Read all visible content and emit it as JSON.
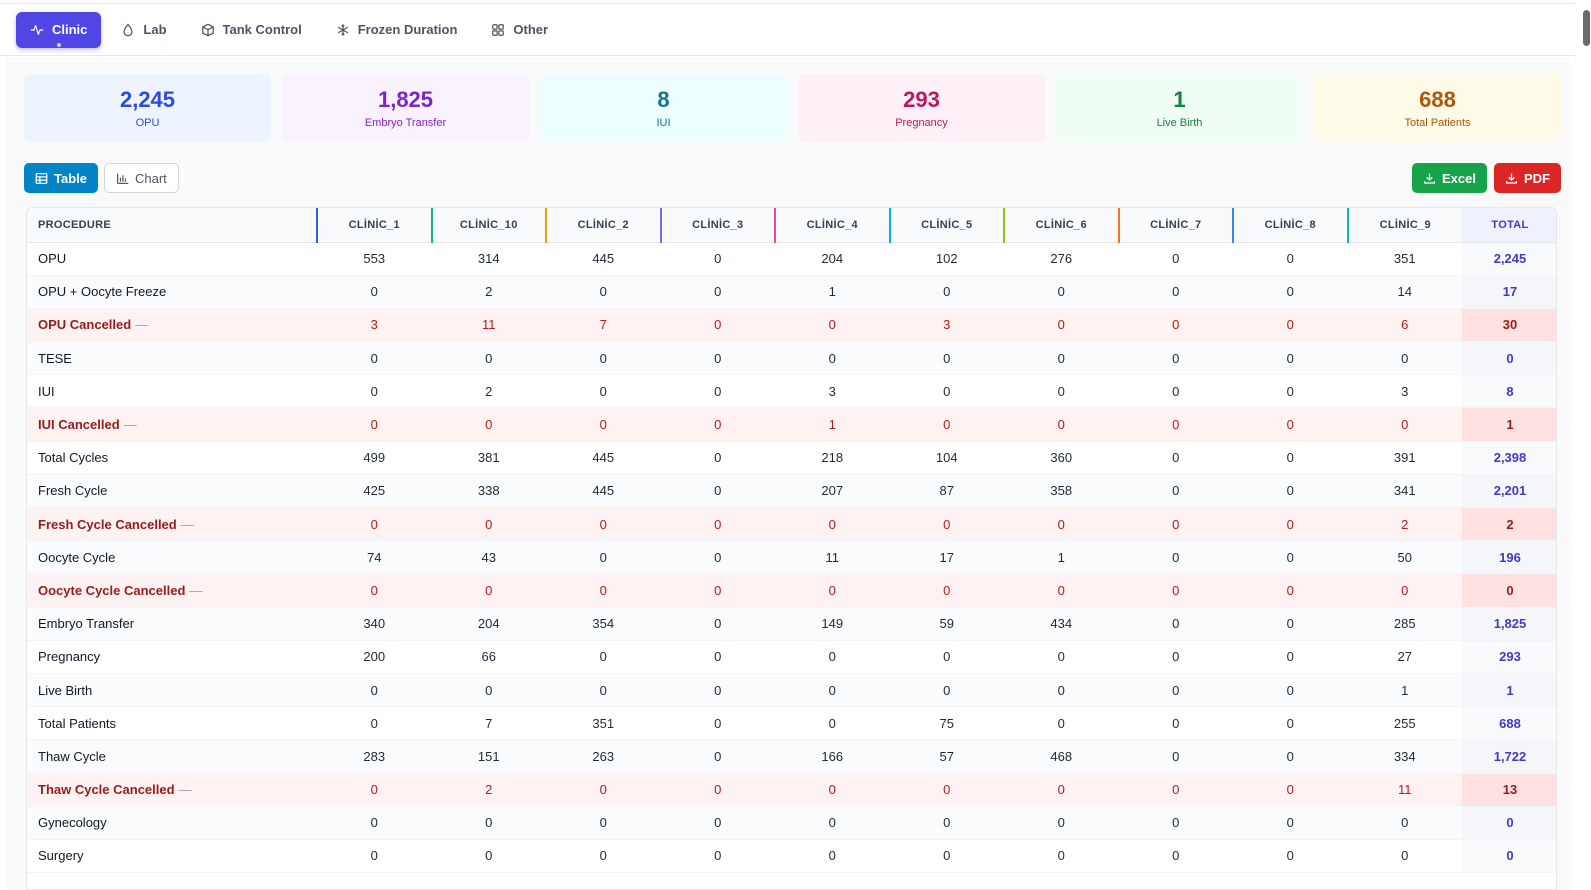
{
  "tabs": [
    {
      "label": "Clinic",
      "icon": "activity-icon",
      "active": true
    },
    {
      "label": "Lab",
      "icon": "droplet-icon",
      "active": false
    },
    {
      "label": "Tank Control",
      "icon": "box-icon",
      "active": false
    },
    {
      "label": "Frozen Duration",
      "icon": "snowflake-icon",
      "active": false
    },
    {
      "label": "Other",
      "icon": "grid-icon",
      "active": false
    }
  ],
  "stats": [
    {
      "value": "2,245",
      "label": "OPU",
      "bg": "#eef4ff",
      "color": "#2b4bd8"
    },
    {
      "value": "1,825",
      "label": "Embryo Transfer",
      "bg": "#faf2ff",
      "color": "#7e22ce"
    },
    {
      "value": "8",
      "label": "IUI",
      "bg": "#ecfeff",
      "color": "#0e7490"
    },
    {
      "value": "293",
      "label": "Pregnancy",
      "bg": "#fdf0f6",
      "color": "#be185d"
    },
    {
      "value": "1",
      "label": "Live Birth",
      "bg": "#f0fdf4",
      "color": "#15803d"
    },
    {
      "value": "688",
      "label": "Total Patients",
      "bg": "#fefce8",
      "color": "#b45309"
    }
  ],
  "toolbar": {
    "table_label": "Table",
    "chart_label": "Chart",
    "excel_label": "Excel",
    "pdf_label": "PDF"
  },
  "table": {
    "proc_header": "PROCEDURE",
    "total_header": "TOTAL",
    "cancel_marker": "—",
    "columns": [
      {
        "label": "CLİNİC_1",
        "color": "#2563eb"
      },
      {
        "label": "CLİNİC_10",
        "color": "#10b981"
      },
      {
        "label": "CLİNİC_2",
        "color": "#f59e0b"
      },
      {
        "label": "CLİNİC_3",
        "color": "#8b5cf6"
      },
      {
        "label": "CLİNİC_4",
        "color": "#ec4899"
      },
      {
        "label": "CLİNİC_5",
        "color": "#06b6d4"
      },
      {
        "label": "CLİNİC_6",
        "color": "#84cc16"
      },
      {
        "label": "CLİNİC_7",
        "color": "#f97316"
      },
      {
        "label": "CLİNİC_8",
        "color": "#3b82f6"
      },
      {
        "label": "CLİNİC_9",
        "color": "#14b8a6"
      }
    ],
    "rows": [
      {
        "name": "OPU",
        "cancel": false,
        "values": [
          "553",
          "314",
          "445",
          "0",
          "204",
          "102",
          "276",
          "0",
          "0",
          "351"
        ],
        "total": "2,245"
      },
      {
        "name": "OPU + Oocyte Freeze",
        "cancel": false,
        "values": [
          "0",
          "2",
          "0",
          "0",
          "1",
          "0",
          "0",
          "0",
          "0",
          "14"
        ],
        "total": "17"
      },
      {
        "name": "OPU Cancelled",
        "cancel": true,
        "values": [
          "3",
          "11",
          "7",
          "0",
          "0",
          "3",
          "0",
          "0",
          "0",
          "6"
        ],
        "total": "30"
      },
      {
        "name": "TESE",
        "cancel": false,
        "values": [
          "0",
          "0",
          "0",
          "0",
          "0",
          "0",
          "0",
          "0",
          "0",
          "0"
        ],
        "total": "0"
      },
      {
        "name": "IUI",
        "cancel": false,
        "values": [
          "0",
          "2",
          "0",
          "0",
          "3",
          "0",
          "0",
          "0",
          "0",
          "3"
        ],
        "total": "8"
      },
      {
        "name": "IUI Cancelled",
        "cancel": true,
        "values": [
          "0",
          "0",
          "0",
          "0",
          "1",
          "0",
          "0",
          "0",
          "0",
          "0"
        ],
        "total": "1"
      },
      {
        "name": "Total Cycles",
        "cancel": false,
        "values": [
          "499",
          "381",
          "445",
          "0",
          "218",
          "104",
          "360",
          "0",
          "0",
          "391"
        ],
        "total": "2,398"
      },
      {
        "name": "Fresh Cycle",
        "cancel": false,
        "values": [
          "425",
          "338",
          "445",
          "0",
          "207",
          "87",
          "358",
          "0",
          "0",
          "341"
        ],
        "total": "2,201"
      },
      {
        "name": "Fresh Cycle Cancelled",
        "cancel": true,
        "values": [
          "0",
          "0",
          "0",
          "0",
          "0",
          "0",
          "0",
          "0",
          "0",
          "2"
        ],
        "total": "2"
      },
      {
        "name": "Oocyte Cycle",
        "cancel": false,
        "values": [
          "74",
          "43",
          "0",
          "0",
          "11",
          "17",
          "1",
          "0",
          "0",
          "50"
        ],
        "total": "196"
      },
      {
        "name": "Oocyte Cycle Cancelled",
        "cancel": true,
        "values": [
          "0",
          "0",
          "0",
          "0",
          "0",
          "0",
          "0",
          "0",
          "0",
          "0"
        ],
        "total": "0"
      },
      {
        "name": "Embryo Transfer",
        "cancel": false,
        "values": [
          "340",
          "204",
          "354",
          "0",
          "149",
          "59",
          "434",
          "0",
          "0",
          "285"
        ],
        "total": "1,825"
      },
      {
        "name": "Pregnancy",
        "cancel": false,
        "values": [
          "200",
          "66",
          "0",
          "0",
          "0",
          "0",
          "0",
          "0",
          "0",
          "27"
        ],
        "total": "293"
      },
      {
        "name": "Live Birth",
        "cancel": false,
        "values": [
          "0",
          "0",
          "0",
          "0",
          "0",
          "0",
          "0",
          "0",
          "0",
          "1"
        ],
        "total": "1"
      },
      {
        "name": "Total Patients",
        "cancel": false,
        "values": [
          "0",
          "7",
          "351",
          "0",
          "0",
          "75",
          "0",
          "0",
          "0",
          "255"
        ],
        "total": "688"
      },
      {
        "name": "Thaw Cycle",
        "cancel": false,
        "values": [
          "283",
          "151",
          "263",
          "0",
          "166",
          "57",
          "468",
          "0",
          "0",
          "334"
        ],
        "total": "1,722"
      },
      {
        "name": "Thaw Cycle Cancelled",
        "cancel": true,
        "values": [
          "0",
          "2",
          "0",
          "0",
          "0",
          "0",
          "0",
          "0",
          "0",
          "11"
        ],
        "total": "13"
      },
      {
        "name": "Gynecology",
        "cancel": false,
        "values": [
          "0",
          "0",
          "0",
          "0",
          "0",
          "0",
          "0",
          "0",
          "0",
          "0"
        ],
        "total": "0"
      },
      {
        "name": "Surgery",
        "cancel": false,
        "values": [
          "0",
          "0",
          "0",
          "0",
          "0",
          "0",
          "0",
          "0",
          "0",
          "0"
        ],
        "total": "0"
      }
    ]
  }
}
